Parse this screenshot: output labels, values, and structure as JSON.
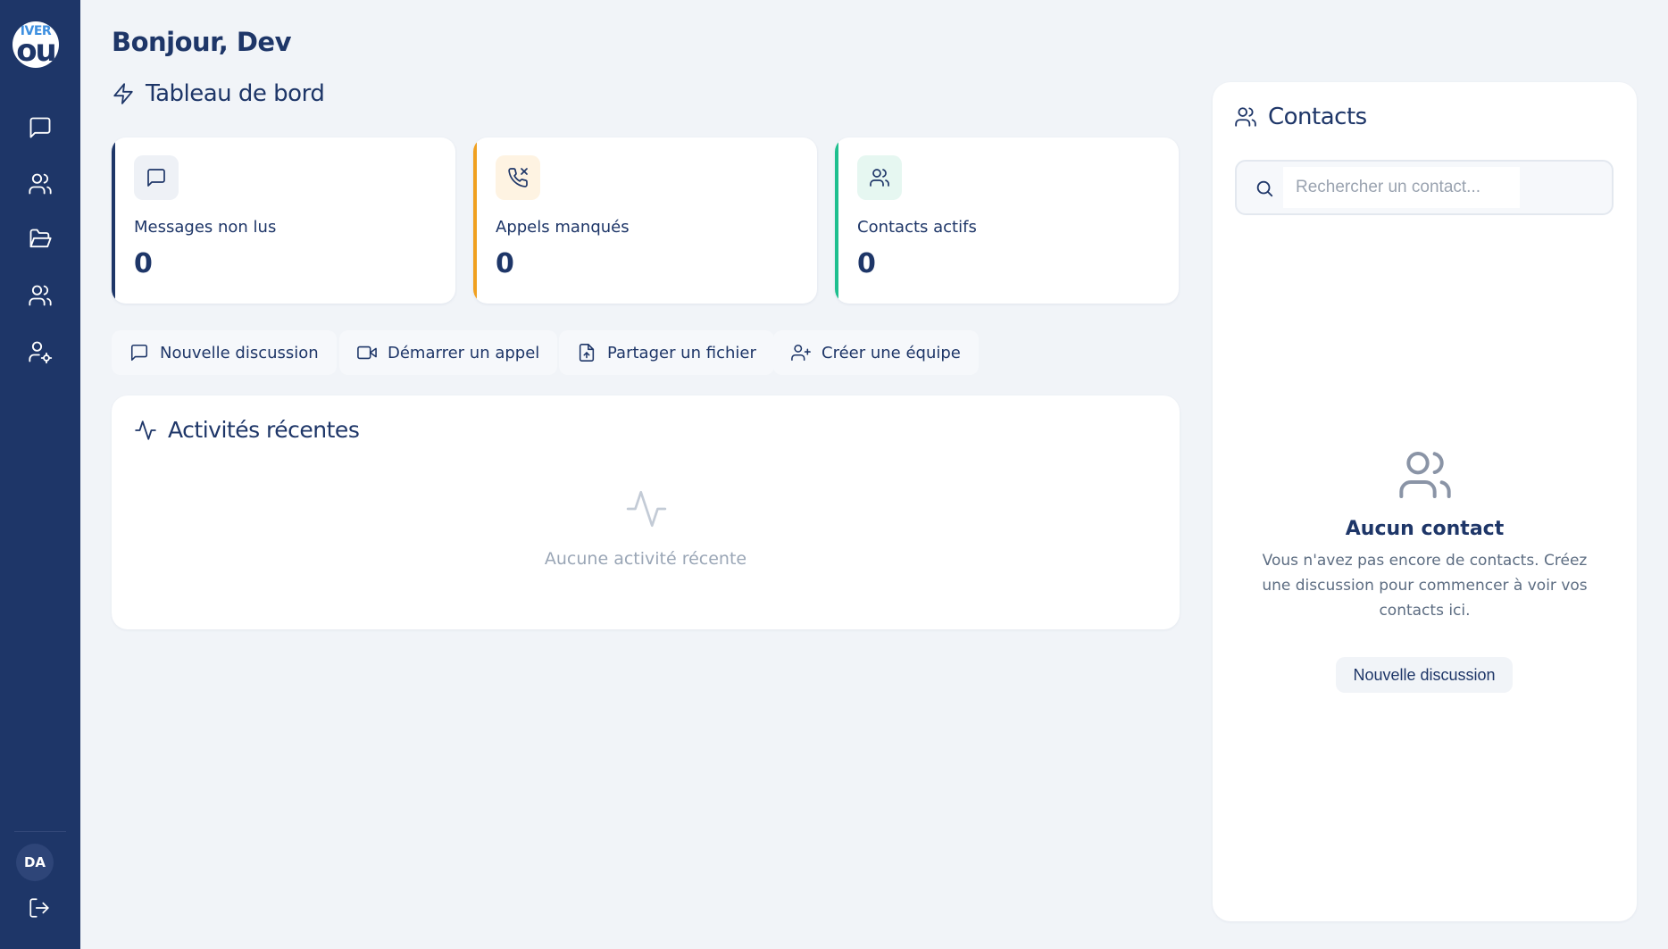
{
  "sidebar": {
    "logo_text_top": "IVER",
    "logo_text_bottom": "ou",
    "nav": [
      {
        "icon": "message-icon"
      },
      {
        "icon": "users-icon"
      },
      {
        "icon": "folder-icon"
      },
      {
        "icon": "team-icon"
      },
      {
        "icon": "user-settings-icon"
      }
    ],
    "avatar_initials": "DA",
    "logout_icon": "logout-icon"
  },
  "header": {
    "greeting": "Bonjour, Dev",
    "dashboard_title": "Tableau de bord"
  },
  "stats": [
    {
      "label": "Messages non lus",
      "value": "0",
      "accent": "#1e3668",
      "icon": "message-icon",
      "icon_bg": "#eef1f6"
    },
    {
      "label": "Appels manqués",
      "value": "0",
      "accent": "#f0a020",
      "icon": "phone-missed-icon",
      "icon_bg": "#fef3e2"
    },
    {
      "label": "Contacts actifs",
      "value": "0",
      "accent": "#1fbf8f",
      "icon": "users-icon",
      "icon_bg": "#e6f7f1"
    }
  ],
  "actions": [
    {
      "label": "Nouvelle discussion",
      "icon": "message-icon"
    },
    {
      "label": "Démarrer un appel",
      "icon": "video-icon"
    },
    {
      "label": "Partager un fichier",
      "icon": "file-upload-icon"
    },
    {
      "label": "Créer une équipe",
      "icon": "user-plus-icon"
    }
  ],
  "activity": {
    "title": "Activités récentes",
    "empty_text": "Aucune activité récente"
  },
  "contacts": {
    "title": "Contacts",
    "search_placeholder": "Rechercher un contact...",
    "empty_title": "Aucun contact",
    "empty_description": "Vous n'avez pas encore de contacts. Créez une discussion pour commencer à voir vos contacts ici.",
    "empty_button": "Nouvelle discussion"
  },
  "colors": {
    "sidebar": "#1e3668",
    "background": "#f1f4f8",
    "text_primary": "#1e3668"
  }
}
